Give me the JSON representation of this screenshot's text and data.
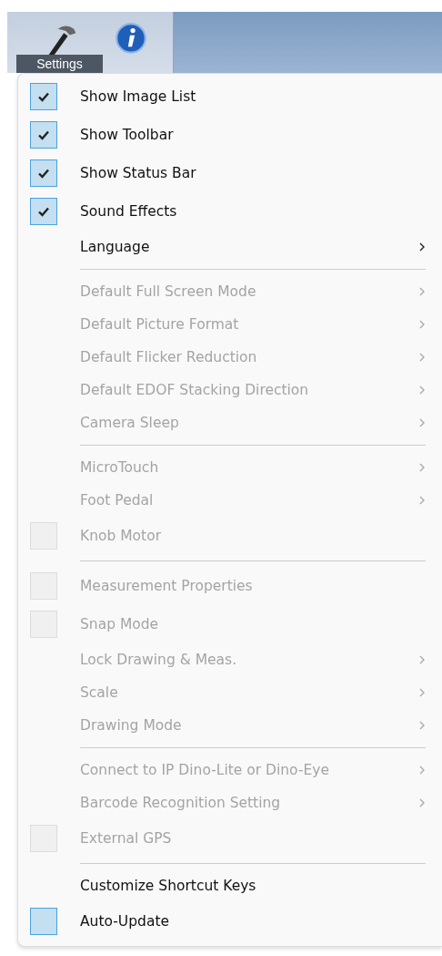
{
  "toolbar": {
    "items": [
      {
        "kind": "settings",
        "label": "Settings"
      },
      {
        "kind": "info"
      }
    ]
  },
  "menu": {
    "items": [
      {
        "kind": "check",
        "label": "Show Image List",
        "checked": true,
        "disabled": false
      },
      {
        "kind": "check",
        "label": "Show Toolbar",
        "checked": true,
        "disabled": false
      },
      {
        "kind": "check",
        "label": "Show Status Bar",
        "checked": true,
        "disabled": false
      },
      {
        "kind": "check",
        "label": "Sound Effects",
        "checked": true,
        "disabled": false
      },
      {
        "kind": "submenu",
        "label": "Language",
        "disabled": false
      },
      {
        "kind": "separator"
      },
      {
        "kind": "submenu",
        "label": "Default Full Screen Mode",
        "disabled": true
      },
      {
        "kind": "submenu",
        "label": "Default Picture Format",
        "disabled": true
      },
      {
        "kind": "submenu",
        "label": "Default Flicker Reduction",
        "disabled": true
      },
      {
        "kind": "submenu",
        "label": "Default EDOF Stacking Direction",
        "disabled": true
      },
      {
        "kind": "submenu",
        "label": "Camera Sleep",
        "disabled": true
      },
      {
        "kind": "separator"
      },
      {
        "kind": "submenu",
        "label": "MicroTouch",
        "disabled": true
      },
      {
        "kind": "submenu",
        "label": "Foot Pedal",
        "disabled": true
      },
      {
        "kind": "check",
        "label": "Knob Motor",
        "checked": false,
        "disabled": true
      },
      {
        "kind": "separator"
      },
      {
        "kind": "check",
        "label": "Measurement Properties",
        "checked": false,
        "disabled": true
      },
      {
        "kind": "check",
        "label": "Snap Mode",
        "checked": false,
        "disabled": true
      },
      {
        "kind": "submenu",
        "label": "Lock Drawing & Meas.",
        "disabled": true
      },
      {
        "kind": "submenu",
        "label": "Scale",
        "disabled": true
      },
      {
        "kind": "submenu",
        "label": "Drawing Mode",
        "disabled": true
      },
      {
        "kind": "separator"
      },
      {
        "kind": "submenu",
        "label": "Connect to IP Dino-Lite or Dino-Eye",
        "disabled": true
      },
      {
        "kind": "submenu",
        "label": "Barcode Recognition Setting",
        "disabled": true
      },
      {
        "kind": "check",
        "label": "External GPS",
        "checked": false,
        "disabled": true
      },
      {
        "kind": "separator"
      },
      {
        "kind": "command",
        "label": "Customize Shortcut Keys",
        "disabled": false
      },
      {
        "kind": "check",
        "label": "Auto-Update",
        "checked": false,
        "disabled": false
      }
    ]
  }
}
